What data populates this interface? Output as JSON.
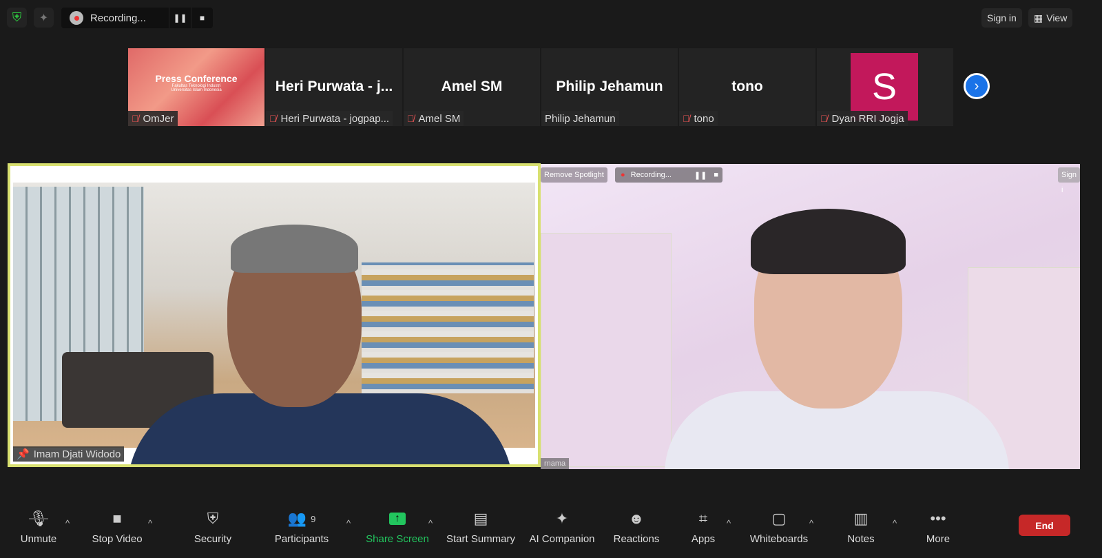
{
  "topbar": {
    "recording_label": "Recording...",
    "sign_in": "Sign in",
    "view": "View"
  },
  "thumbnails": [
    {
      "big": "",
      "slide_title": "Press Conference",
      "slide_sub1": "Fakultas Teknologi Industri",
      "slide_sub2": "Universitas Islam Indonesia",
      "name": "OmJer",
      "muted": true
    },
    {
      "big": "Heri  Purwata - j...",
      "name": "Heri Purwata - jogpap...",
      "muted": true
    },
    {
      "big": "Amel SM",
      "name": "Amel SM",
      "muted": true
    },
    {
      "big": "Philip Jehamun",
      "name": "Philip Jehamun",
      "muted": false
    },
    {
      "big": "tono",
      "name": "tono",
      "muted": true
    },
    {
      "avatar_letter": "S",
      "avatar_color": "#c2185b",
      "name": "Dyan RRI Jogja",
      "muted": true
    }
  ],
  "main": {
    "left_name": "Imam Djati Widodo",
    "right_name": "rnama",
    "right_overlay": {
      "remove_spotlight": "Remove Spotlight",
      "recording": "Recording...",
      "sign_in": "Sign i"
    },
    "active_speaker_color": "#d8e070"
  },
  "toolbar": {
    "items": [
      {
        "label": "Unmute",
        "icon": "mic-muted-icon"
      },
      {
        "label": "Stop Video",
        "icon": "video-icon"
      },
      {
        "label": "Security",
        "icon": "shield-icon"
      },
      {
        "label": "Participants",
        "icon": "participants-icon",
        "count": "9"
      },
      {
        "label": "Share Screen",
        "icon": "share-screen-icon"
      },
      {
        "label": "Start Summary",
        "icon": "summary-icon"
      },
      {
        "label": "AI Companion",
        "icon": "sparkle-icon"
      },
      {
        "label": "Reactions",
        "icon": "reaction-icon"
      },
      {
        "label": "Apps",
        "icon": "apps-icon"
      },
      {
        "label": "Whiteboards",
        "icon": "whiteboard-icon"
      },
      {
        "label": "Notes",
        "icon": "notes-icon"
      },
      {
        "label": "More",
        "icon": "more-icon"
      }
    ],
    "end": "End",
    "share_color": "#22c55e",
    "end_color": "#c62828"
  }
}
